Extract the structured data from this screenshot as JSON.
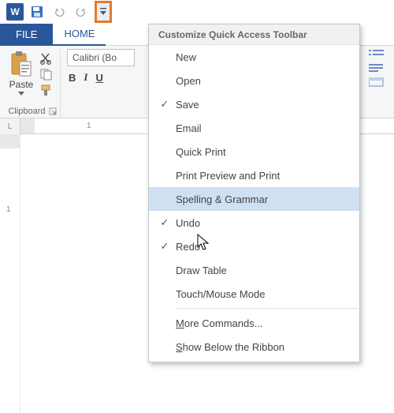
{
  "qat": {
    "word_letter": "W"
  },
  "tabs": {
    "file": "FILE",
    "home": "HOME"
  },
  "ribbon": {
    "paste_label": "Paste",
    "clipboard_group": "Clipboard",
    "font_name": "Calibri (Bo",
    "bold": "B",
    "italic": "I",
    "underline": "U"
  },
  "ruler": {
    "corner": "L",
    "h1": "1",
    "v1": "1"
  },
  "menu": {
    "title": "Customize Quick Access Toolbar",
    "items": [
      {
        "label": "New",
        "checked": false
      },
      {
        "label": "Open",
        "checked": false
      },
      {
        "label": "Save",
        "checked": true
      },
      {
        "label": "Email",
        "checked": false
      },
      {
        "label": "Quick Print",
        "checked": false
      },
      {
        "label": "Print Preview and Print",
        "checked": false
      },
      {
        "label": "Spelling & Grammar",
        "checked": false,
        "hover": true
      },
      {
        "label": "Undo",
        "checked": true
      },
      {
        "label": "Redo",
        "checked": true
      },
      {
        "label": "Draw Table",
        "checked": false
      },
      {
        "label": "Touch/Mouse Mode",
        "checked": false
      }
    ],
    "more_commands_pre": "",
    "more_commands_mn": "M",
    "more_commands_post": "ore Commands...",
    "show_below_pre": "",
    "show_below_mn": "S",
    "show_below_post": "how Below the Ribbon"
  }
}
